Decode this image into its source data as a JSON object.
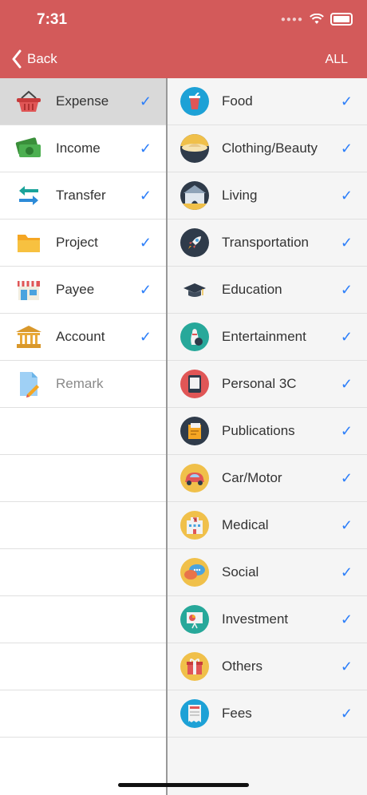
{
  "status": {
    "time": "7:31"
  },
  "header": {
    "back_label": "Back",
    "all_label": "ALL",
    "background": "#d35a5a"
  },
  "left_menu": [
    {
      "label": "Expense",
      "checked": true,
      "selected": true,
      "icon": "basket-icon"
    },
    {
      "label": "Income",
      "checked": true,
      "icon": "money-icon"
    },
    {
      "label": "Transfer",
      "checked": true,
      "icon": "transfer-arrows-icon"
    },
    {
      "label": "Project",
      "checked": true,
      "icon": "folder-icon"
    },
    {
      "label": "Payee",
      "checked": true,
      "icon": "shop-icon"
    },
    {
      "label": "Account",
      "checked": true,
      "icon": "bank-icon"
    },
    {
      "label": "Remark",
      "checked": false,
      "icon": "note-pencil-icon"
    }
  ],
  "categories": [
    {
      "label": "Food",
      "icon": "drink-icon",
      "color": "#1da1d6"
    },
    {
      "label": "Clothing/Beauty",
      "icon": "hat-icon",
      "color": "#2f3b4a"
    },
    {
      "label": "Living",
      "icon": "house-icon",
      "color": "#2f3b4a"
    },
    {
      "label": "Transportation",
      "icon": "rocket-icon",
      "color": "#2f3b4a"
    },
    {
      "label": "Education",
      "icon": "graduation-cap-icon",
      "color": "#f5f5f5"
    },
    {
      "label": "Entertainment",
      "icon": "bowling-icon",
      "color": "#27a89a"
    },
    {
      "label": "Personal 3C",
      "icon": "phone-icon",
      "color": "#e05656"
    },
    {
      "label": "Publications",
      "icon": "book-icon",
      "color": "#2f3b4a"
    },
    {
      "label": "Car/Motor",
      "icon": "car-icon",
      "color": "#f0c04a"
    },
    {
      "label": "Medical",
      "icon": "hospital-icon",
      "color": "#f0c04a"
    },
    {
      "label": "Social",
      "icon": "chat-icon",
      "color": "#f0c04a"
    },
    {
      "label": "Investment",
      "icon": "presentation-icon",
      "color": "#27a89a"
    },
    {
      "label": "Others",
      "icon": "gift-icon",
      "color": "#f0c04a"
    },
    {
      "label": "Fees",
      "icon": "receipt-icon",
      "color": "#1da1d6"
    }
  ],
  "check_color": "#2d7ff9"
}
